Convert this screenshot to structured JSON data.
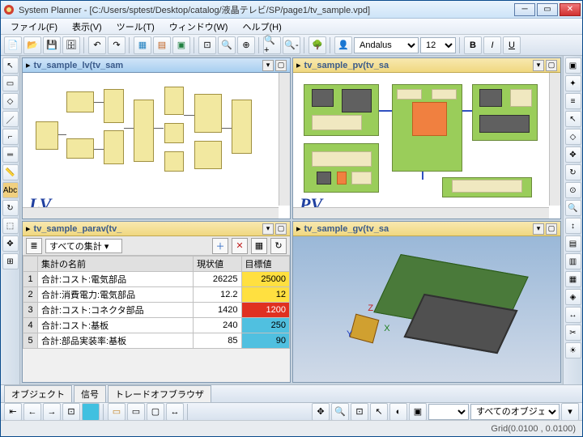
{
  "app_name": "System Planner",
  "file_path": "C:/Users/sptest/Desktop/catalog/液晶テレビ/SP/page1/tv_sample.vpd",
  "menu": {
    "file": "ファイル(F)",
    "view": "表示(V)",
    "tool": "ツール(T)",
    "window": "ウィンドウ(W)",
    "help": "ヘルプ(H)"
  },
  "toolbar": {
    "font_name": "Andalus",
    "font_size": "12"
  },
  "panels": {
    "lv": {
      "title": "tv_sample_lv(tv_sam",
      "overlay": "LV"
    },
    "pv": {
      "title": "tv_sample_pv(tv_sa",
      "overlay": "PV"
    },
    "param": {
      "title": "tv_sample_parav(tv_"
    },
    "gv": {
      "title": "tv_sample_gv(tv_sa"
    }
  },
  "param_toolbar": {
    "aggregate_label": "すべての集計"
  },
  "param_table": {
    "headers": {
      "name": "集計の名前",
      "current": "現状値",
      "target": "目標値"
    },
    "rows": [
      {
        "idx": "1",
        "name": "合計:コスト:電気部品",
        "current": "26225",
        "target": "25000",
        "target_class": "tgt-yellow"
      },
      {
        "idx": "2",
        "name": "合計:消費電力:電気部品",
        "current": "12.2",
        "target": "12",
        "target_class": "tgt-yellow"
      },
      {
        "idx": "3",
        "name": "合計:コスト:コネクタ部品",
        "current": "1420",
        "target": "1200",
        "target_class": "tgt-red"
      },
      {
        "idx": "4",
        "name": "合計:コスト:基板",
        "current": "240",
        "target": "250",
        "target_class": "tgt-cyan"
      },
      {
        "idx": "5",
        "name": "合計:部品実装率:基板",
        "current": "85",
        "target": "90",
        "target_class": "tgt-cyan"
      }
    ]
  },
  "tabs": {
    "object": "オブジェクト",
    "signal": "信号",
    "tradeoff": "トレードオフブラウザ"
  },
  "bottom_toolbar": {
    "all_objects": "すべてのオブジェクト"
  },
  "status": {
    "grid": "Grid(0.0100 , 0.0100)"
  },
  "gv_axis": {
    "x": "X",
    "y": "Y",
    "z": "Z"
  }
}
